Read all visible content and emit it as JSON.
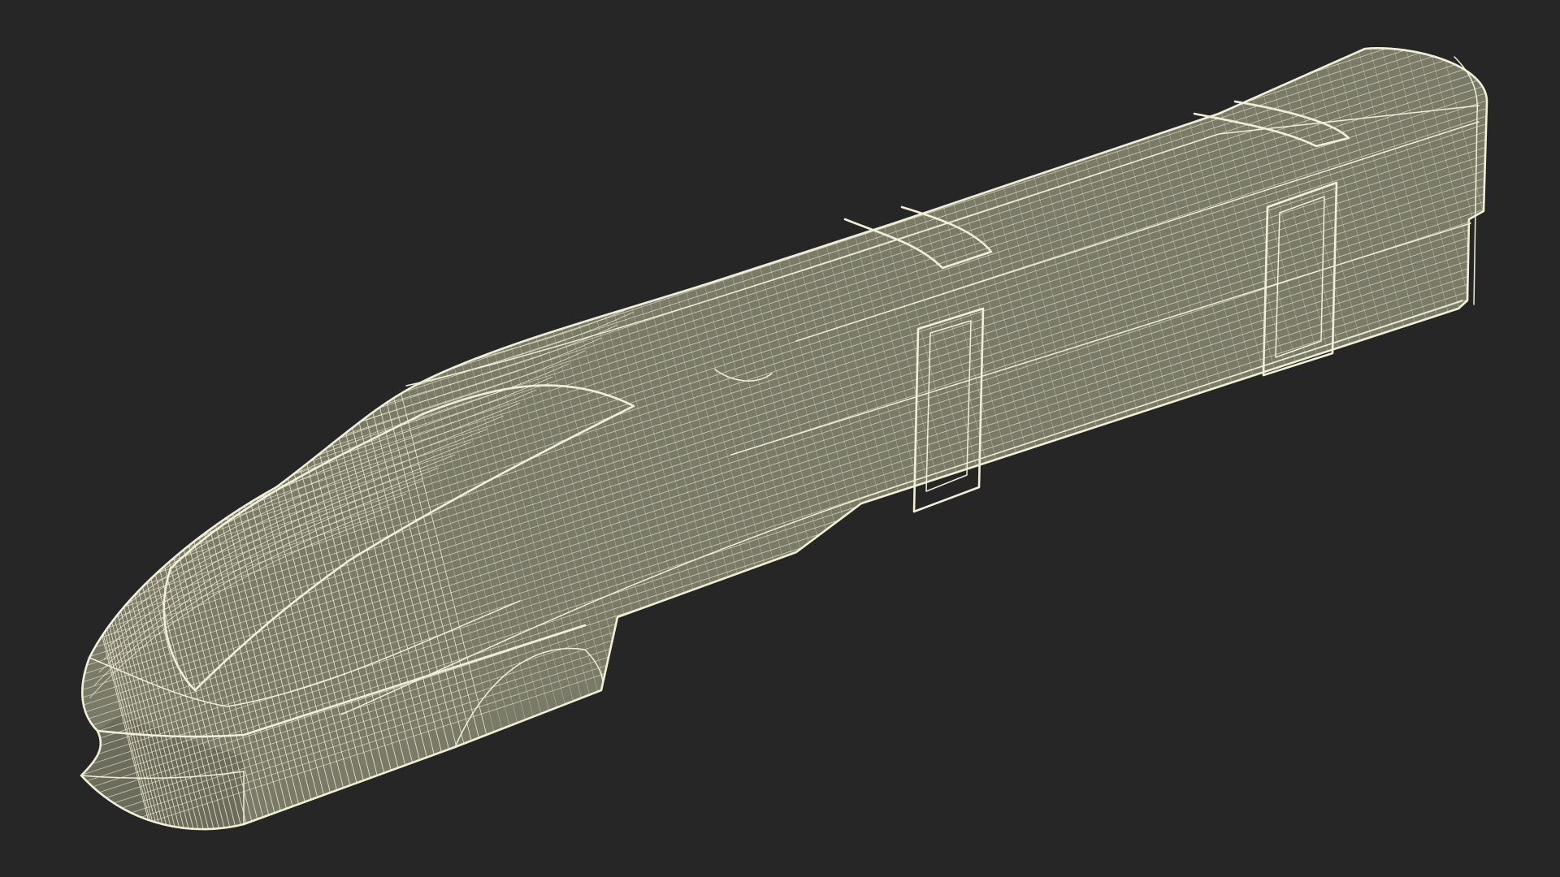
{
  "viewport": {
    "background_color": "#262626"
  },
  "model": {
    "subject": "high-speed-train-head-car",
    "display_mode": "wireframe-over-shaded",
    "surface_color": "#7a7a68",
    "surface_dark_color": "#6c6c5c",
    "wire_color": "#f2efd8"
  }
}
